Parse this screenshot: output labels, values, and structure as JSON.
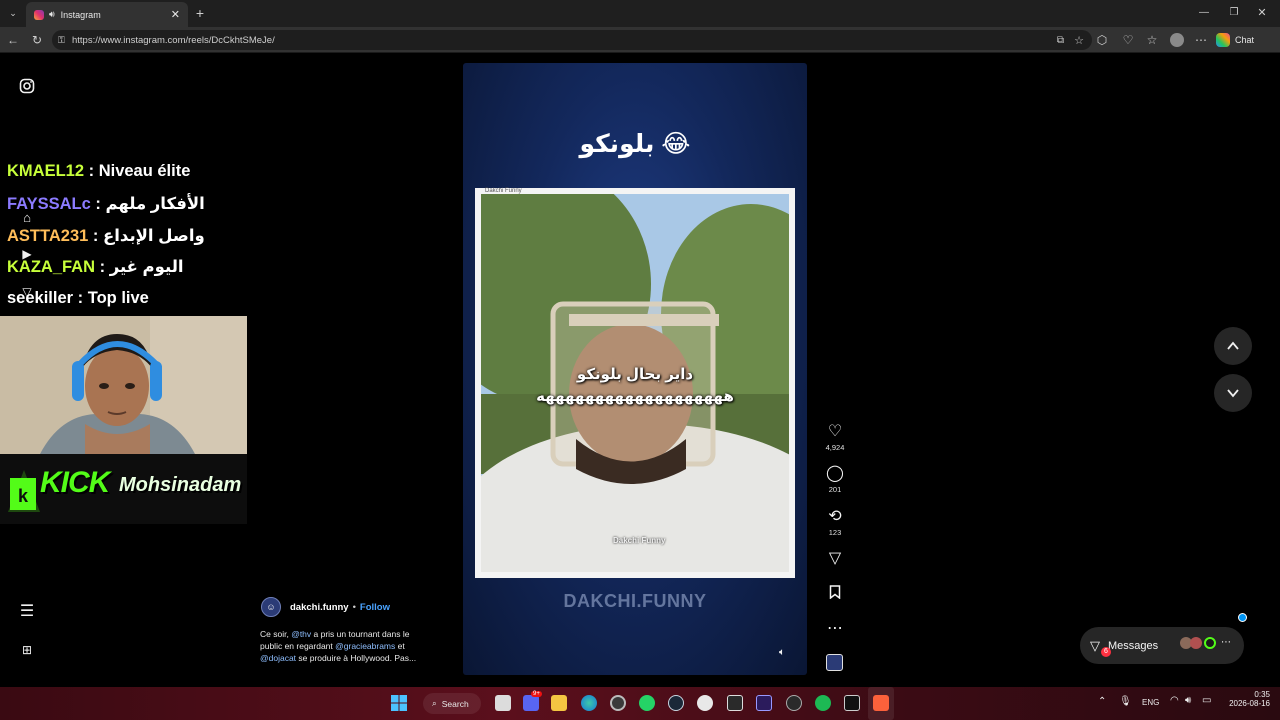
{
  "browser": {
    "tab_title": "Instagram",
    "url": "https://www.instagram.com/reels/DcCkhtSMeJe/",
    "copilot_label": "Chat"
  },
  "stream_chat": [
    {
      "user": "KMAEL12",
      "sep": " : ",
      "msg": "Niveau élite",
      "color": "#c7ff3a"
    },
    {
      "user": "FAYSSALc",
      "sep": " : ",
      "msg": "الأفكار ملهم",
      "color": "#8c7bff"
    },
    {
      "user": "ASTTA231",
      "sep": " : ",
      "msg": "واصل الإبداع",
      "color": "#ffbe5a"
    },
    {
      "user": "KAZA_FAN",
      "sep": " : ",
      "msg": "اليوم غير",
      "color": "#c7ff3a"
    },
    {
      "user": "seekiller",
      "sep": " : ",
      "msg": "Top live",
      "color": "#ffffff"
    }
  ],
  "kick_banner": {
    "prefix": "KICK",
    "name": "Mohsinadam"
  },
  "reel": {
    "title": "بلونكو 😂",
    "caption_line1": "داير بحال بلونكو",
    "caption_line2": "هههههههههههههههههههه",
    "watermark": "DAKCHI.FUNNY",
    "frame_tag": "Dakchi Funny",
    "video_logo": "Dakchi Funny"
  },
  "actions": {
    "likes": "4,924",
    "comments": "201",
    "reposts": "123"
  },
  "author": {
    "name": "dakchi.funny",
    "follow_label": "Follow",
    "desc_parts": [
      "Ce soir, ",
      "@thv",
      " a pris un tournant dans le public en regardant ",
      "@gracieabrams",
      " et ",
      "@dojacat",
      " se produire à Hollywood. Pas..."
    ]
  },
  "messages": {
    "label": "Messages",
    "badge": "6"
  },
  "taskbar": {
    "search_label": "Search",
    "lang": "ENG",
    "time": "0:35",
    "date": "2026-08-16",
    "chat_badge": "9+"
  },
  "colors": {
    "instagram_accent": "#0095f6",
    "badge_red": "#ff3040"
  }
}
